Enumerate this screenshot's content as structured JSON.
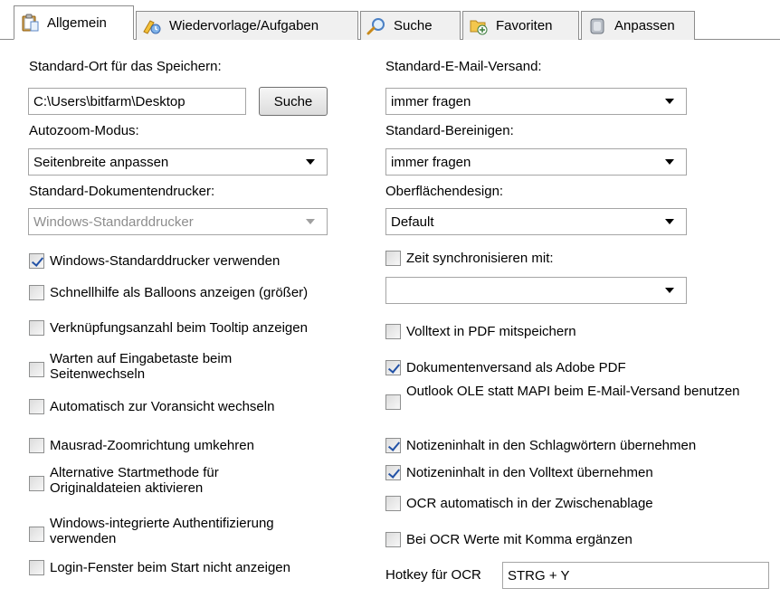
{
  "tabs": [
    {
      "label": "Allgemein",
      "icon": "clipboard-icon",
      "active": true
    },
    {
      "label": "Wiedervorlage/Aufgaben",
      "icon": "tasks-icon",
      "active": false
    },
    {
      "label": "Suche",
      "icon": "magnifier-icon",
      "active": false
    },
    {
      "label": "Favoriten",
      "icon": "favorites-icon",
      "active": false
    },
    {
      "label": "Anpassen",
      "icon": "customize-icon",
      "active": false
    }
  ],
  "left": {
    "save_location_label": "Standard-Ort für das Speichern:",
    "save_location_value": "C:\\Users\\bitfarm\\Desktop",
    "search_button": "Suche",
    "autozoom_label": "Autozoom-Modus:",
    "autozoom_value": "Seitenbreite anpassen",
    "printer_label": "Standard-Dokumentendrucker:",
    "printer_value": "Windows-Standarddrucker",
    "checkboxes": [
      {
        "label": "Windows-Standarddrucker verwenden",
        "checked": true
      },
      {
        "label": "Schnellhilfe als Balloons anzeigen (größer)",
        "checked": false
      },
      {
        "label": "Verknüpfungsanzahl beim Tooltip anzeigen",
        "checked": false
      },
      {
        "label": "Warten auf Eingabetaste beim Seitenwechseln",
        "checked": false
      },
      {
        "label": "Automatisch zur Voransicht wechseln",
        "checked": false
      },
      {
        "label": "Mausrad-Zoomrichtung umkehren",
        "checked": false
      },
      {
        "label": "Alternative Startmethode für Originaldateien aktivieren",
        "checked": false
      },
      {
        "label": "Windows-integrierte Authentifizierung verwenden",
        "checked": false
      },
      {
        "label": "Login-Fenster beim Start nicht anzeigen",
        "checked": false
      }
    ]
  },
  "right": {
    "email_label": "Standard-E-Mail-Versand:",
    "email_value": "immer fragen",
    "cleanup_label": "Standard-Bereinigen:",
    "cleanup_value": "immer fragen",
    "design_label": "Oberflächendesign:",
    "design_value": "Default",
    "sync_label": "Zeit synchronisieren mit:",
    "sync_checked": false,
    "sync_value": "",
    "checkboxes": [
      {
        "label": "Volltext in PDF mitspeichern",
        "checked": false
      },
      {
        "label": "Dokumentenversand als Adobe PDF",
        "checked": true
      },
      {
        "label": "Outlook OLE statt MAPI beim E-Mail-Versand benutzen",
        "checked": false
      },
      {
        "label": "Notizeninhalt in den Schlagwörtern übernehmen",
        "checked": true
      },
      {
        "label": "Notizeninhalt in den Volltext übernehmen",
        "checked": true
      },
      {
        "label": "OCR automatisch in der Zwischenablage",
        "checked": false
      },
      {
        "label": "Bei OCR Werte mit Komma ergänzen",
        "checked": false
      }
    ],
    "hotkey_label": "Hotkey für OCR",
    "hotkey_value": "STRG + Y"
  }
}
